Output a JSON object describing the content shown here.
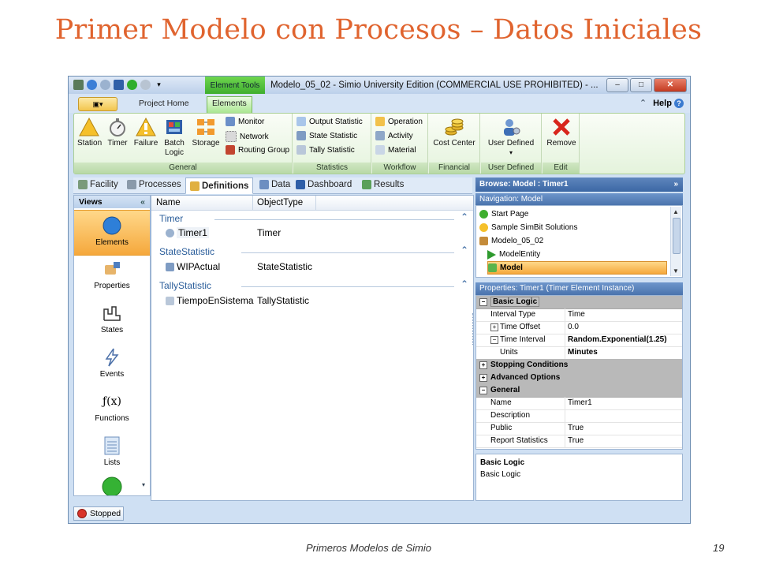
{
  "slide": {
    "title": "Primer Modelo con Procesos – Datos Iniciales",
    "footer": "Primeros Modelos de Simio",
    "page": "19"
  },
  "window": {
    "title": "Modelo_05_02 - Simio University Edition (COMMERCIAL USE PROHIBITED) - ...",
    "context_tab": "Element Tools",
    "controls": {
      "minimize": "–",
      "maximize": "□",
      "close": "✕"
    }
  },
  "ribbon": {
    "tabs": [
      "Project Home",
      "Elements"
    ],
    "active_tab": "Elements",
    "help": "Help",
    "groups": {
      "general": {
        "label": "General",
        "big": [
          "Station",
          "Timer",
          "Failure",
          "Batch Logic",
          "Storage"
        ],
        "small": [
          "Monitor",
          "Network",
          "Routing Group"
        ]
      },
      "statistics": {
        "label": "Statistics",
        "small": [
          "Output Statistic",
          "State Statistic",
          "Tally Statistic"
        ]
      },
      "workflow": {
        "label": "Workflow",
        "small": [
          "Operation",
          "Activity",
          "Material"
        ]
      },
      "financial": {
        "label": "Financial",
        "big": [
          "Cost Center"
        ]
      },
      "user_defined": {
        "label": "User Defined",
        "big": [
          "User Defined"
        ]
      },
      "edit": {
        "label": "Edit",
        "big": [
          "Remove"
        ]
      }
    }
  },
  "doc_tabs": [
    "Facility",
    "Processes",
    "Definitions",
    "Data",
    "Dashboard",
    "Results"
  ],
  "doc_active": "Definitions",
  "views": {
    "header": "Views",
    "items": [
      "Elements",
      "Properties",
      "States",
      "Events",
      "Functions",
      "Lists"
    ],
    "active": "Elements"
  },
  "elements_grid": {
    "columns": [
      "Name",
      "ObjectType"
    ],
    "groups": [
      {
        "name": "Timer",
        "rows": [
          {
            "name": "Timer1",
            "type": "Timer"
          }
        ]
      },
      {
        "name": "StateStatistic",
        "rows": [
          {
            "name": "WIPActual",
            "type": "StateStatistic"
          }
        ]
      },
      {
        "name": "TallyStatistic",
        "rows": [
          {
            "name": "TiempoEnSistema",
            "type": "TallyStatistic"
          }
        ]
      }
    ]
  },
  "browse": {
    "title": "Browse: Model : Timer1",
    "nav_header": "Navigation: Model",
    "nav_items": [
      "Start Page",
      "Sample SimBit Solutions",
      "Modelo_05_02",
      "ModelEntity",
      "Model"
    ],
    "nav_selected": "Model"
  },
  "properties": {
    "header": "Properties: Timer1 (Timer Element Instance)",
    "basic_logic": "Basic Logic",
    "interval_type": {
      "k": "Interval Type",
      "v": "Time"
    },
    "time_offset": {
      "k": "Time Offset",
      "v": "0.0"
    },
    "time_interval": {
      "k": "Time Interval",
      "v": "Random.Exponential(1.25)"
    },
    "units": {
      "k": "Units",
      "v": "Minutes"
    },
    "stopping": "Stopping Conditions",
    "advanced": "Advanced Options",
    "general": "General",
    "name": {
      "k": "Name",
      "v": "Timer1"
    },
    "description": {
      "k": "Description",
      "v": ""
    },
    "public": {
      "k": "Public",
      "v": "True"
    },
    "report": {
      "k": "Report Statistics",
      "v": "True"
    }
  },
  "description_box": {
    "title": "Basic Logic",
    "text": "Basic Logic"
  },
  "status": {
    "run_state": "Stopped"
  },
  "colors": {
    "title_orange": "#e0642f",
    "ribbon_green": "#3fae2f",
    "selection_orange": "#f5a83c",
    "header_blue": "#3c67a4"
  }
}
